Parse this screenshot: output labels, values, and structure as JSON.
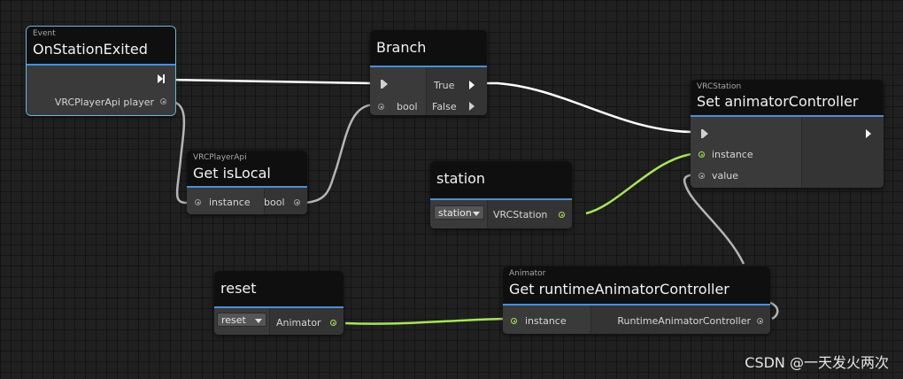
{
  "nodes": {
    "event": {
      "category": "Event",
      "title": "OnStationExited",
      "output_label": "VRCPlayerApi player"
    },
    "branch": {
      "title": "Branch",
      "input_label": "bool",
      "true_label": "True",
      "false_label": "False"
    },
    "set_controller": {
      "category": "VRCStation",
      "title": "Set animatorController",
      "instance_label": "instance",
      "value_label": "value"
    },
    "get_islocal": {
      "category": "VRCPlayerApi",
      "title": "Get isLocal",
      "input_label": "instance",
      "output_label": "bool"
    },
    "station_var": {
      "title": "station",
      "dropdown_value": "station",
      "output_label": "VRCStation"
    },
    "reset_var": {
      "title": "reset",
      "dropdown_value": "reset",
      "output_label": "Animator"
    },
    "get_runtime": {
      "category": "Animator",
      "title": "Get runtimeAnimatorController",
      "input_label": "instance",
      "output_label": "RuntimeAnimatorController"
    }
  },
  "colors": {
    "flow_wire": "#ffffff",
    "typed_wire": "#a7e55a",
    "generic_wire": "#b5b5b5",
    "header_accent": "#4a8fd6",
    "selection": "#6fb6d8"
  },
  "watermark": "CSDN @一天发火两次"
}
